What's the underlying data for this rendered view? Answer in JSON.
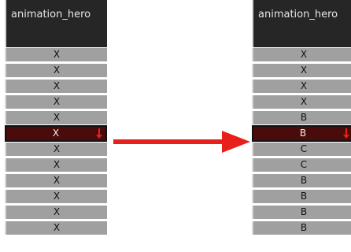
{
  "left_column": {
    "header": "animation_hero",
    "cells": [
      "X",
      "X",
      "X",
      "X",
      "X",
      "X",
      "X",
      "X",
      "X",
      "X",
      "X",
      "X"
    ],
    "selected_index": 5
  },
  "right_column": {
    "header": "animation_hero",
    "cells": [
      "X",
      "X",
      "X",
      "X",
      "B",
      "B",
      "C",
      "C",
      "B",
      "B",
      "B",
      "B"
    ],
    "selected_index": 5
  },
  "colors": {
    "arrow": "#e8201c",
    "selected_cell": "#4a0b0b",
    "cell": "#a0a0a0",
    "header": "#262626"
  },
  "icons": {
    "cell_marker": "down-arrow-icon",
    "transition": "right-arrow-icon"
  }
}
